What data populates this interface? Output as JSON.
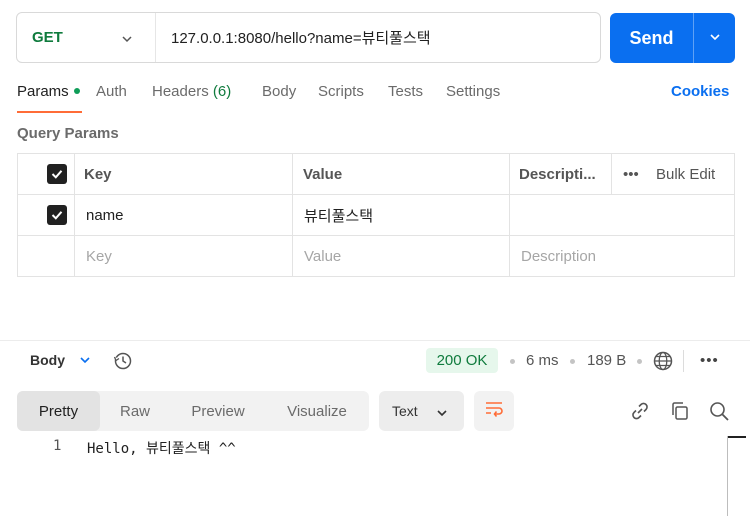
{
  "request": {
    "method": "GET",
    "url": "127.0.0.1:8080/hello?name=뷰티풀스택",
    "send_label": "Send"
  },
  "tabs": [
    {
      "label": "Params",
      "active": true
    },
    {
      "label": "Auth"
    },
    {
      "label": "Headers",
      "count": "(6)"
    },
    {
      "label": "Body"
    },
    {
      "label": "Scripts"
    },
    {
      "label": "Tests"
    },
    {
      "label": "Settings"
    }
  ],
  "cookies_label": "Cookies",
  "query_params": {
    "title": "Query Params",
    "headers": {
      "key": "Key",
      "value": "Value",
      "description": "Descripti...",
      "bulk_edit": "Bulk Edit"
    },
    "rows": [
      {
        "checked": true,
        "key": "name",
        "value": "뷰티풀스택",
        "description": ""
      }
    ],
    "placeholder": {
      "key": "Key",
      "value": "Value",
      "description": "Description"
    }
  },
  "response": {
    "section_label": "Body",
    "status": "200 OK",
    "time": "6 ms",
    "size": "189 B",
    "more": "•••",
    "view_tabs": [
      "Pretty",
      "Raw",
      "Preview",
      "Visualize"
    ],
    "active_view": "Pretty",
    "format": "Text",
    "lines": [
      {
        "number": "1",
        "text": "Hello, 뷰티풀스택 ^^"
      }
    ]
  },
  "colors": {
    "send": "#0a6ff0",
    "method": "#0f7b3d",
    "tab_active_underline": "#ff6c37",
    "status_bg": "#e6f7ec",
    "link": "#0a6ff0"
  },
  "icons": [
    "chevron-down-icon",
    "history-icon",
    "globe-icon",
    "wrap-lines-icon",
    "link-icon",
    "copy-icon",
    "search-icon",
    "checkbox-icon"
  ]
}
